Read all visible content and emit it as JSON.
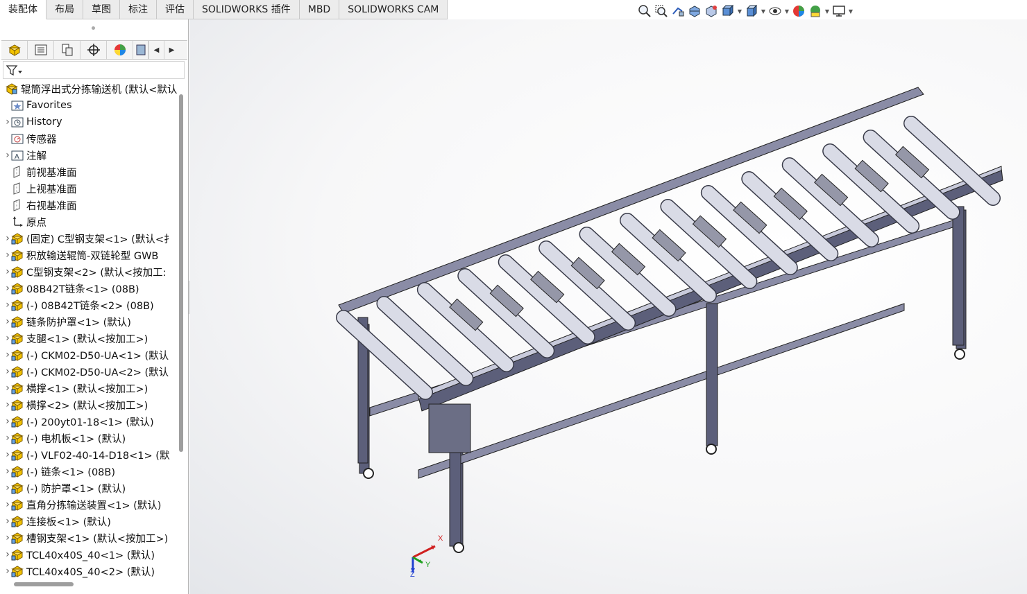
{
  "command_tabs": [
    {
      "label": "装配体",
      "active": true
    },
    {
      "label": "布局",
      "active": false
    },
    {
      "label": "草图",
      "active": false
    },
    {
      "label": "标注",
      "active": false
    },
    {
      "label": "评估",
      "active": false
    },
    {
      "label": "SOLIDWORKS 插件",
      "active": false
    },
    {
      "label": "MBD",
      "active": false
    },
    {
      "label": "SOLIDWORKS CAM",
      "active": false
    }
  ],
  "heads_up_toolbar": [
    "zoom-to-fit-icon",
    "zoom-area-icon",
    "previous-view-icon",
    "section-view-icon",
    "dynamic-annotation-icon",
    "view-orientation-icon",
    "display-style-icon",
    "hide-show-icon",
    "edit-appearance-icon",
    "apply-scene-icon",
    "view-settings-icon"
  ],
  "manager_tabs": [
    "featuremanager-icon",
    "propertymanager-icon",
    "configurationmanager-icon",
    "dimxpert-icon",
    "display-manager-icon",
    "cam-manager-icon"
  ],
  "tree": {
    "root": "辊筒浮出式分拣输送机  (默认<默认",
    "items": [
      {
        "label": "Favorites",
        "icon": "favorites-folder-icon",
        "expandable": false
      },
      {
        "label": "History",
        "icon": "history-folder-icon",
        "expandable": true
      },
      {
        "label": "传感器",
        "icon": "sensor-folder-icon",
        "expandable": false
      },
      {
        "label": "注解",
        "icon": "annotation-folder-icon",
        "expandable": true
      },
      {
        "label": "前视基准面",
        "icon": "plane-icon",
        "expandable": false
      },
      {
        "label": "上视基准面",
        "icon": "plane-icon",
        "expandable": false
      },
      {
        "label": "右视基准面",
        "icon": "plane-icon",
        "expandable": false
      },
      {
        "label": "原点",
        "icon": "origin-icon",
        "expandable": false
      },
      {
        "label": "(固定) C型钢支架<1> (默认<扌",
        "icon": "part-icon",
        "expandable": true
      },
      {
        "label": "积放输送辊筒-双链轮型 GWB",
        "icon": "part-icon",
        "expandable": true
      },
      {
        "label": "C型钢支架<2> (默认<按加工:",
        "icon": "part-icon",
        "expandable": true
      },
      {
        "label": "08B42T链条<1> (08B)",
        "icon": "part-icon",
        "expandable": true
      },
      {
        "label": "(-) 08B42T链条<2> (08B)",
        "icon": "part-icon",
        "expandable": true
      },
      {
        "label": "链条防护罩<1> (默认)",
        "icon": "part-icon",
        "expandable": true
      },
      {
        "label": "支腿<1> (默认<按加工>)",
        "icon": "part-icon",
        "expandable": true
      },
      {
        "label": "(-) CKM02-D50-UA<1> (默认",
        "icon": "part-icon",
        "expandable": true
      },
      {
        "label": "(-) CKM02-D50-UA<2> (默认",
        "icon": "part-icon",
        "expandable": true
      },
      {
        "label": "横撑<1> (默认<按加工>)",
        "icon": "part-icon",
        "expandable": true
      },
      {
        "label": "横撑<2> (默认<按加工>)",
        "icon": "part-icon",
        "expandable": true
      },
      {
        "label": "(-) 200yt01-18<1> (默认)",
        "icon": "part-icon",
        "expandable": true
      },
      {
        "label": "(-) 电机板<1> (默认)",
        "icon": "part-icon",
        "expandable": true
      },
      {
        "label": "(-) VLF02-40-14-D18<1> (默",
        "icon": "part-icon",
        "expandable": true
      },
      {
        "label": "(-) 链条<1> (08B)",
        "icon": "part-icon",
        "expandable": true
      },
      {
        "label": "(-) 防护罩<1> (默认)",
        "icon": "part-icon",
        "expandable": true
      },
      {
        "label": "直角分拣输送装置<1> (默认)",
        "icon": "part-icon",
        "expandable": true
      },
      {
        "label": "连接板<1> (默认)",
        "icon": "part-icon",
        "expandable": true
      },
      {
        "label": "槽钢支架<1> (默认<按加工>)",
        "icon": "part-icon",
        "expandable": true
      },
      {
        "label": "TCL40x40S_40<1> (默认)",
        "icon": "part-icon",
        "expandable": true
      },
      {
        "label": "TCL40x40S_40<2> (默认)",
        "icon": "part-icon",
        "expandable": true
      }
    ]
  },
  "triad": {
    "x": "X",
    "y": "Y",
    "z": "Z",
    "color_x": "#d02020",
    "color_y": "#20a020",
    "color_z": "#2040d0"
  },
  "colors": {
    "frame": "#5c5f7a",
    "frame_light": "#8a8ca6",
    "roller": "#d9dbe6",
    "viewport_bg": "#ffffff"
  }
}
